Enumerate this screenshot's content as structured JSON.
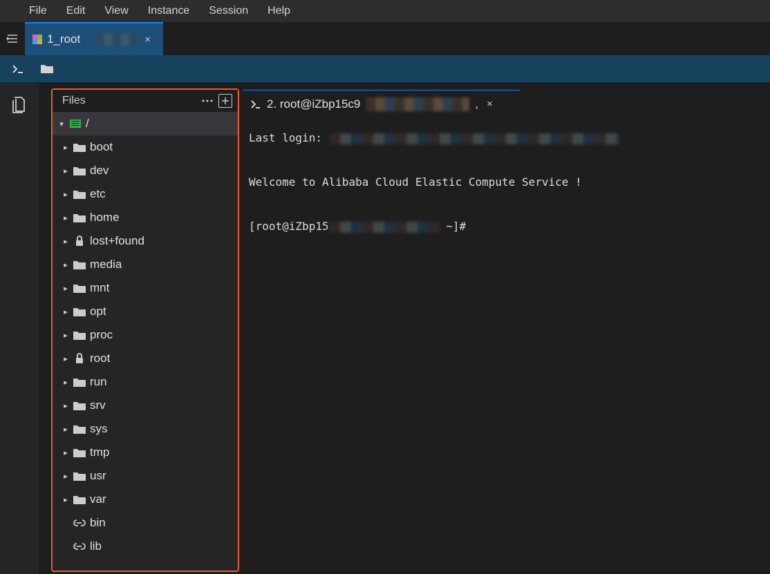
{
  "menubar": [
    "File",
    "Edit",
    "View",
    "Instance",
    "Session",
    "Help"
  ],
  "main_tab": {
    "title": "1_root",
    "close": "×"
  },
  "files_panel": {
    "title": "Files",
    "root_label": "/",
    "items": [
      {
        "name": "boot",
        "icon": "folder"
      },
      {
        "name": "dev",
        "icon": "folder"
      },
      {
        "name": "etc",
        "icon": "folder"
      },
      {
        "name": "home",
        "icon": "folder"
      },
      {
        "name": "lost+found",
        "icon": "lock"
      },
      {
        "name": "media",
        "icon": "folder"
      },
      {
        "name": "mnt",
        "icon": "folder"
      },
      {
        "name": "opt",
        "icon": "folder"
      },
      {
        "name": "proc",
        "icon": "folder"
      },
      {
        "name": "root",
        "icon": "lock"
      },
      {
        "name": "run",
        "icon": "folder"
      },
      {
        "name": "srv",
        "icon": "folder"
      },
      {
        "name": "sys",
        "icon": "folder"
      },
      {
        "name": "tmp",
        "icon": "folder"
      },
      {
        "name": "usr",
        "icon": "folder"
      },
      {
        "name": "var",
        "icon": "folder"
      },
      {
        "name": "bin",
        "icon": "link",
        "leaf": true
      },
      {
        "name": "lib",
        "icon": "link",
        "leaf": true
      }
    ]
  },
  "terminal_tab": {
    "prefix": "2. root@iZbp15c9",
    "suffix": ",",
    "close": "×"
  },
  "terminal": {
    "last_login_label": "Last login: ",
    "welcome": "Welcome to Alibaba Cloud Elastic Compute Service !",
    "prompt_prefix": "[root@iZbp15",
    "prompt_suffix": " ~]#"
  }
}
